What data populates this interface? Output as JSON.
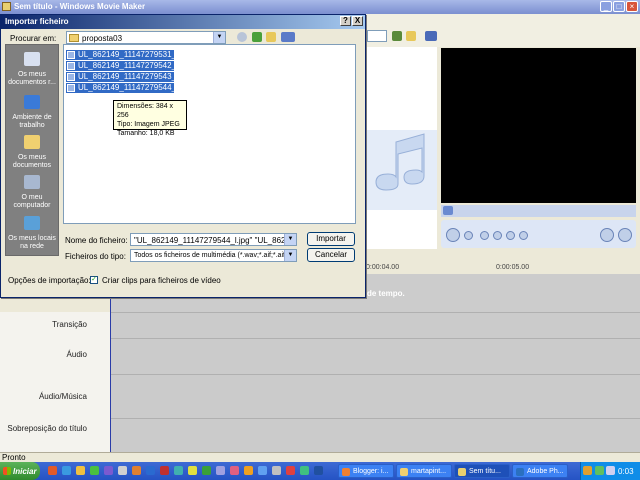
{
  "app": {
    "title": "Sem título - Windows Movie Maker",
    "status": "Pronto",
    "storyboard_hint": "de tempo.",
    "ruler": [
      "0:00:04.00",
      "0:00:05.00"
    ],
    "tracks": [
      "Transição",
      "Áudio",
      "Áudio/Música",
      "Sobreposição do título"
    ]
  },
  "dialog": {
    "title": "Importar ficheiro",
    "help_btn": "?",
    "close_btn": "X",
    "look_in_label": "Procurar em:",
    "look_in_value": "proposta03",
    "places": [
      "Os meus documentos r...",
      "Ambiente de trabalho",
      "Os meus documentos",
      "O meu computador",
      "Os meus locais na rede"
    ],
    "files": [
      "UL_862149_11147279531_l.jpg",
      "UL_862149_11147279542_l.jpg",
      "UL_862149_11147279543_l.jpg",
      "UL_862149_11147279544_l.jpg"
    ],
    "tooltip": [
      "Dimensões: 384 x 256",
      "Tipo: Imagem JPEG",
      "Tamanho: 18,0 KB"
    ],
    "filename_label": "Nome do ficheiro:",
    "filename_value": "\"UL_862149_11147279544_l.jpg\" \"UL_862149_1",
    "filetype_label": "Ficheiros do tipo:",
    "filetype_value": "Todos os ficheiros de multimédia (*.wav;*.aif;*.aiff;",
    "import_btn": "Importar",
    "cancel_btn": "Cancelar",
    "import_options_label": "Opções de importação:",
    "create_clips_label": "Criar clips para ficheiros de vídeo",
    "create_clips_checked": "✓"
  },
  "taskbar": {
    "start": "Iniciar",
    "buttons": [
      "Blogger: i...",
      "martapint...",
      "Sem títu...",
      "Adobe Ph..."
    ],
    "clock": "0:03"
  }
}
